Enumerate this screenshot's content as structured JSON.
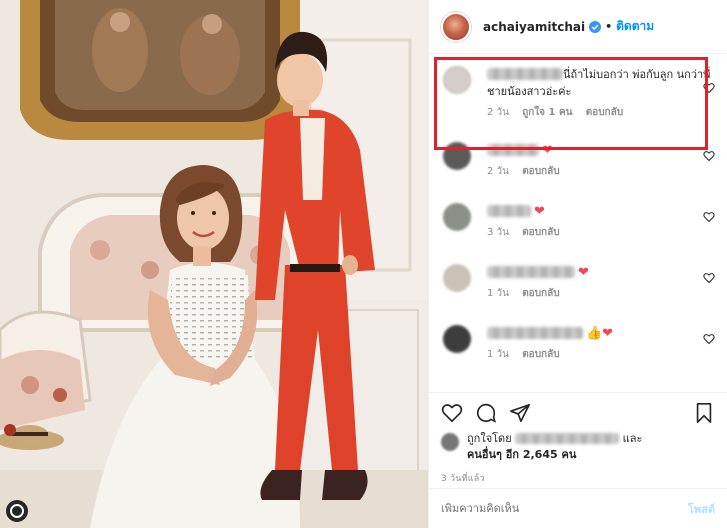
{
  "post_header": {
    "username": "achaiyamitchai",
    "separator": "•",
    "follow_label": "ติดตาม"
  },
  "comments": [
    {
      "text": "นี่ถ้าไม่บอกว่า พ่อกับลูก นกว่าพี่ชายน้องสาวอ่ะค่ะ",
      "age": "2 วัน",
      "likes": "ถูกใจ 1 คน",
      "reply": "ตอบกลับ",
      "highlighted": true
    },
    {
      "emoji": "❤",
      "age": "2 วัน",
      "reply": "ตอบกลับ"
    },
    {
      "emoji": "❤",
      "age": "3 วัน",
      "reply": "ตอบกลับ"
    },
    {
      "emoji": "❤",
      "age": "1 วัน",
      "reply": "ตอบกลับ"
    },
    {
      "emoji": "👍❤",
      "age": "1 วัน",
      "reply": "ตอบกลับ"
    }
  ],
  "likes": {
    "prefix": "ถูกใจโดย",
    "and": "และ",
    "others": "คนอื่นๆ อีก 2,645 คน"
  },
  "posted_ago": "3 วันที่แล้ว",
  "add_comment": {
    "placeholder": "เพิ่มความคิดเห็น",
    "post_label": "โพสต์"
  },
  "colors": {
    "highlight_box": "#e0202a",
    "link_blue": "#0095f6",
    "heart_red": "#ed4956"
  }
}
